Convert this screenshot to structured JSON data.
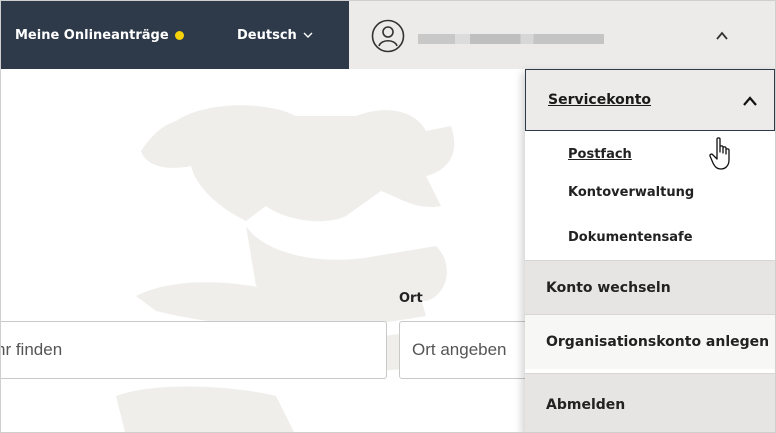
{
  "header": {
    "online_requests_label": "Meine Onlineanträge",
    "language_label": "Deutsch",
    "user_icon": "user-circle-icon",
    "dot_color": "#f5d20a",
    "bar_color": "#2e3a4a"
  },
  "search": {
    "location_label": "Ort",
    "query_value": "hr finden",
    "location_placeholder": "Ort angeben"
  },
  "menu": {
    "section_title": "Servicekonto",
    "subitems": [
      {
        "label": "Postfach"
      },
      {
        "label": "Kontoverwaltung"
      },
      {
        "label": "Dokumentensafe"
      }
    ],
    "items": [
      {
        "label": "Konto wechseln"
      },
      {
        "label": "Organisationskonto anlegen"
      },
      {
        "label": "Abmelden"
      }
    ]
  }
}
